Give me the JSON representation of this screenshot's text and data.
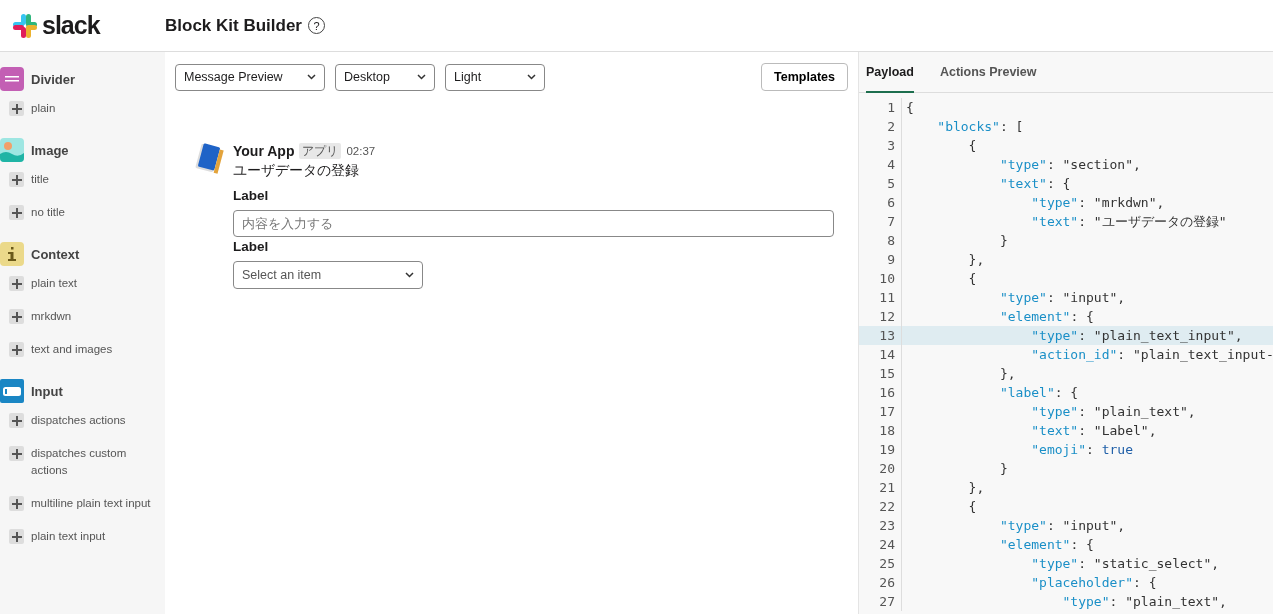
{
  "header": {
    "brand": "slack",
    "title": "Block Kit Builder",
    "help": "?"
  },
  "sidebar": {
    "sections": [
      {
        "kind": "divider",
        "title": "Divider",
        "items": [
          "plain"
        ]
      },
      {
        "kind": "image",
        "title": "Image",
        "items": [
          "title",
          "no title"
        ]
      },
      {
        "kind": "context",
        "title": "Context",
        "items": [
          "plain text",
          "mrkdwn",
          "text and images"
        ]
      },
      {
        "kind": "input",
        "title": "Input",
        "items": [
          "dispatches actions",
          "dispatches custom actions",
          "multiline plain text input",
          "plain text input"
        ]
      }
    ]
  },
  "toolbar": {
    "dropdowns": [
      {
        "value": "Message Preview"
      },
      {
        "value": "Desktop"
      },
      {
        "value": "Light"
      }
    ],
    "button": "Templates"
  },
  "message": {
    "sender": "Your App",
    "badge": "アプリ",
    "time": "02:37",
    "text": "ユーザデータの登録",
    "blocks": [
      {
        "kind": "text_input",
        "label": "Label",
        "placeholder": "内容を入力する"
      },
      {
        "kind": "select",
        "label": "Label",
        "placeholder": "Select an item"
      }
    ]
  },
  "panel": {
    "tabs": [
      {
        "label": "Payload",
        "selected": true
      },
      {
        "label": "Actions Preview",
        "selected": false
      }
    ],
    "code_lines": [
      {
        "number": "1",
        "text": "{",
        "highlighted": false
      },
      {
        "number": "2",
        "text": "    \"blocks\": [",
        "highlighted": false
      },
      {
        "number": "3",
        "text": "        {",
        "highlighted": false
      },
      {
        "number": "4",
        "text": "            \"type\": \"section\",",
        "highlighted": false
      },
      {
        "number": "5",
        "text": "            \"text\": {",
        "highlighted": false
      },
      {
        "number": "6",
        "text": "                \"type\": \"mrkdwn\",",
        "highlighted": false
      },
      {
        "number": "7",
        "text": "                \"text\": \"ユーザデータの登録\"",
        "highlighted": false
      },
      {
        "number": "8",
        "text": "            }",
        "highlighted": false
      },
      {
        "number": "9",
        "text": "        },",
        "highlighted": false
      },
      {
        "number": "10",
        "text": "        {",
        "highlighted": false
      },
      {
        "number": "11",
        "text": "            \"type\": \"input\",",
        "highlighted": false
      },
      {
        "number": "12",
        "text": "            \"element\": {",
        "highlighted": false
      },
      {
        "number": "13",
        "text": "                \"type\": \"plain_text_input\",",
        "highlighted": true
      },
      {
        "number": "14",
        "text": "                \"action_id\": \"plain_text_input-",
        "highlighted": false
      },
      {
        "number": "15",
        "text": "            },",
        "highlighted": false
      },
      {
        "number": "16",
        "text": "            \"label\": {",
        "highlighted": false
      },
      {
        "number": "17",
        "text": "                \"type\": \"plain_text\",",
        "highlighted": false
      },
      {
        "number": "18",
        "text": "                \"text\": \"Label\",",
        "highlighted": false
      },
      {
        "number": "19",
        "text": "                \"emoji\": true",
        "highlighted": false
      },
      {
        "number": "20",
        "text": "            }",
        "highlighted": false
      },
      {
        "number": "21",
        "text": "        },",
        "highlighted": false
      },
      {
        "number": "22",
        "text": "        {",
        "highlighted": false
      },
      {
        "number": "23",
        "text": "            \"type\": \"input\",",
        "highlighted": false
      },
      {
        "number": "24",
        "text": "            \"element\": {",
        "highlighted": false
      },
      {
        "number": "25",
        "text": "                \"type\": \"static_select\",",
        "highlighted": false
      },
      {
        "number": "26",
        "text": "                \"placeholder\": {",
        "highlighted": false
      },
      {
        "number": "27",
        "text": "                    \"type\": \"plain_text\",",
        "highlighted": false
      }
    ]
  }
}
